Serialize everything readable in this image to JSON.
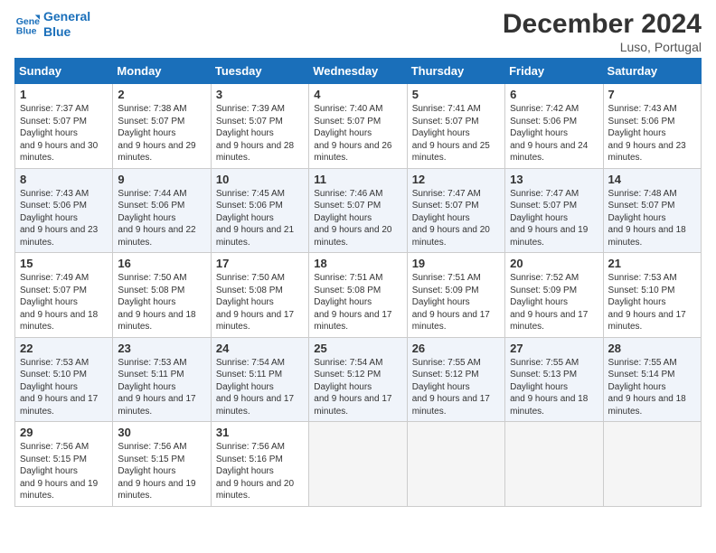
{
  "logo": {
    "line1": "General",
    "line2": "Blue"
  },
  "title": "December 2024",
  "location": "Luso, Portugal",
  "weekdays": [
    "Sunday",
    "Monday",
    "Tuesday",
    "Wednesday",
    "Thursday",
    "Friday",
    "Saturday"
  ],
  "weeks": [
    [
      {
        "day": "1",
        "rise": "7:37 AM",
        "set": "5:07 PM",
        "daylight": "9 hours and 30 minutes."
      },
      {
        "day": "2",
        "rise": "7:38 AM",
        "set": "5:07 PM",
        "daylight": "9 hours and 29 minutes."
      },
      {
        "day": "3",
        "rise": "7:39 AM",
        "set": "5:07 PM",
        "daylight": "9 hours and 28 minutes."
      },
      {
        "day": "4",
        "rise": "7:40 AM",
        "set": "5:07 PM",
        "daylight": "9 hours and 26 minutes."
      },
      {
        "day": "5",
        "rise": "7:41 AM",
        "set": "5:07 PM",
        "daylight": "9 hours and 25 minutes."
      },
      {
        "day": "6",
        "rise": "7:42 AM",
        "set": "5:06 PM",
        "daylight": "9 hours and 24 minutes."
      },
      {
        "day": "7",
        "rise": "7:43 AM",
        "set": "5:06 PM",
        "daylight": "9 hours and 23 minutes."
      }
    ],
    [
      {
        "day": "8",
        "rise": "7:43 AM",
        "set": "5:06 PM",
        "daylight": "9 hours and 23 minutes."
      },
      {
        "day": "9",
        "rise": "7:44 AM",
        "set": "5:06 PM",
        "daylight": "9 hours and 22 minutes."
      },
      {
        "day": "10",
        "rise": "7:45 AM",
        "set": "5:06 PM",
        "daylight": "9 hours and 21 minutes."
      },
      {
        "day": "11",
        "rise": "7:46 AM",
        "set": "5:07 PM",
        "daylight": "9 hours and 20 minutes."
      },
      {
        "day": "12",
        "rise": "7:47 AM",
        "set": "5:07 PM",
        "daylight": "9 hours and 20 minutes."
      },
      {
        "day": "13",
        "rise": "7:47 AM",
        "set": "5:07 PM",
        "daylight": "9 hours and 19 minutes."
      },
      {
        "day": "14",
        "rise": "7:48 AM",
        "set": "5:07 PM",
        "daylight": "9 hours and 18 minutes."
      }
    ],
    [
      {
        "day": "15",
        "rise": "7:49 AM",
        "set": "5:07 PM",
        "daylight": "9 hours and 18 minutes."
      },
      {
        "day": "16",
        "rise": "7:50 AM",
        "set": "5:08 PM",
        "daylight": "9 hours and 18 minutes."
      },
      {
        "day": "17",
        "rise": "7:50 AM",
        "set": "5:08 PM",
        "daylight": "9 hours and 17 minutes."
      },
      {
        "day": "18",
        "rise": "7:51 AM",
        "set": "5:08 PM",
        "daylight": "9 hours and 17 minutes."
      },
      {
        "day": "19",
        "rise": "7:51 AM",
        "set": "5:09 PM",
        "daylight": "9 hours and 17 minutes."
      },
      {
        "day": "20",
        "rise": "7:52 AM",
        "set": "5:09 PM",
        "daylight": "9 hours and 17 minutes."
      },
      {
        "day": "21",
        "rise": "7:53 AM",
        "set": "5:10 PM",
        "daylight": "9 hours and 17 minutes."
      }
    ],
    [
      {
        "day": "22",
        "rise": "7:53 AM",
        "set": "5:10 PM",
        "daylight": "9 hours and 17 minutes."
      },
      {
        "day": "23",
        "rise": "7:53 AM",
        "set": "5:11 PM",
        "daylight": "9 hours and 17 minutes."
      },
      {
        "day": "24",
        "rise": "7:54 AM",
        "set": "5:11 PM",
        "daylight": "9 hours and 17 minutes."
      },
      {
        "day": "25",
        "rise": "7:54 AM",
        "set": "5:12 PM",
        "daylight": "9 hours and 17 minutes."
      },
      {
        "day": "26",
        "rise": "7:55 AM",
        "set": "5:12 PM",
        "daylight": "9 hours and 17 minutes."
      },
      {
        "day": "27",
        "rise": "7:55 AM",
        "set": "5:13 PM",
        "daylight": "9 hours and 18 minutes."
      },
      {
        "day": "28",
        "rise": "7:55 AM",
        "set": "5:14 PM",
        "daylight": "9 hours and 18 minutes."
      }
    ],
    [
      {
        "day": "29",
        "rise": "7:56 AM",
        "set": "5:15 PM",
        "daylight": "9 hours and 19 minutes."
      },
      {
        "day": "30",
        "rise": "7:56 AM",
        "set": "5:15 PM",
        "daylight": "9 hours and 19 minutes."
      },
      {
        "day": "31",
        "rise": "7:56 AM",
        "set": "5:16 PM",
        "daylight": "9 hours and 20 minutes."
      },
      null,
      null,
      null,
      null
    ]
  ]
}
